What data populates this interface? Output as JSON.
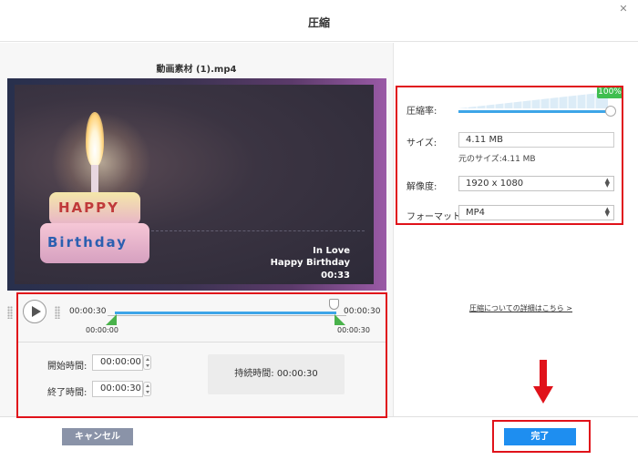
{
  "window": {
    "title": "圧縮"
  },
  "left": {
    "filename": "動画素材 (1).mp4",
    "video_overlay": {
      "line1": "In Love",
      "line2": "Happy Birthday",
      "line3": "00:33"
    },
    "cake_text": {
      "line1": "HAPPY",
      "line2": "Birthday"
    },
    "trim": {
      "time_left": "00:00:30",
      "time_right": "00:00:30",
      "under_left": "00:00:00",
      "under_right": "00:00:30",
      "start_label": "開始時間:",
      "start_value": "00:00:00",
      "end_label": "終了時間:",
      "end_value": "00:00:30",
      "duration_label": "持続時間:",
      "duration_value": "00:00:30"
    }
  },
  "settings": {
    "rate_label": "圧縮率:",
    "rate_percent": "100%",
    "size_label": "サイズ:",
    "size_value": "4.11 MB",
    "original_size": "元のサイズ:4.11 MB",
    "resolution_label": "解像度:",
    "resolution_value": "1920 x 1080",
    "format_label": "フォーマット:",
    "format_value": "MP4",
    "details_link": "圧縮についての詳細はこちら >"
  },
  "footer": {
    "cancel_label": "キャンセル",
    "done_label": "完了"
  },
  "colors": {
    "accent": "#1e8ef0",
    "track": "#3da5e8",
    "handle": "#49b24b",
    "highlight": "#e0121a"
  }
}
